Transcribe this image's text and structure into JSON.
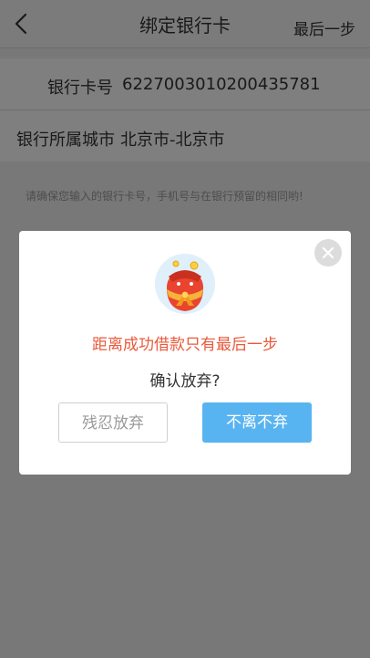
{
  "header": {
    "title": "绑定银行卡",
    "right_action": "最后一步"
  },
  "form": {
    "card_label": "银行卡号",
    "card_value": "6227003010200435781",
    "city_label": "银行所属城市",
    "city_value": "北京市-北京市"
  },
  "notice": "请确保您输入的银行卡号，手机号与在银行预留的相同哟!",
  "dialog": {
    "headline": "距离成功借款只有最后一步",
    "question": "确认放弃?",
    "giveup_label": "残忍放弃",
    "stay_label": "不离不弃"
  },
  "colors": {
    "accent_red": "#e85a3c",
    "primary_blue": "#58b4f1"
  },
  "icons": {
    "back": "chevron-left-icon",
    "close": "close-icon",
    "mascot": "red-envelope-mascot-icon"
  }
}
